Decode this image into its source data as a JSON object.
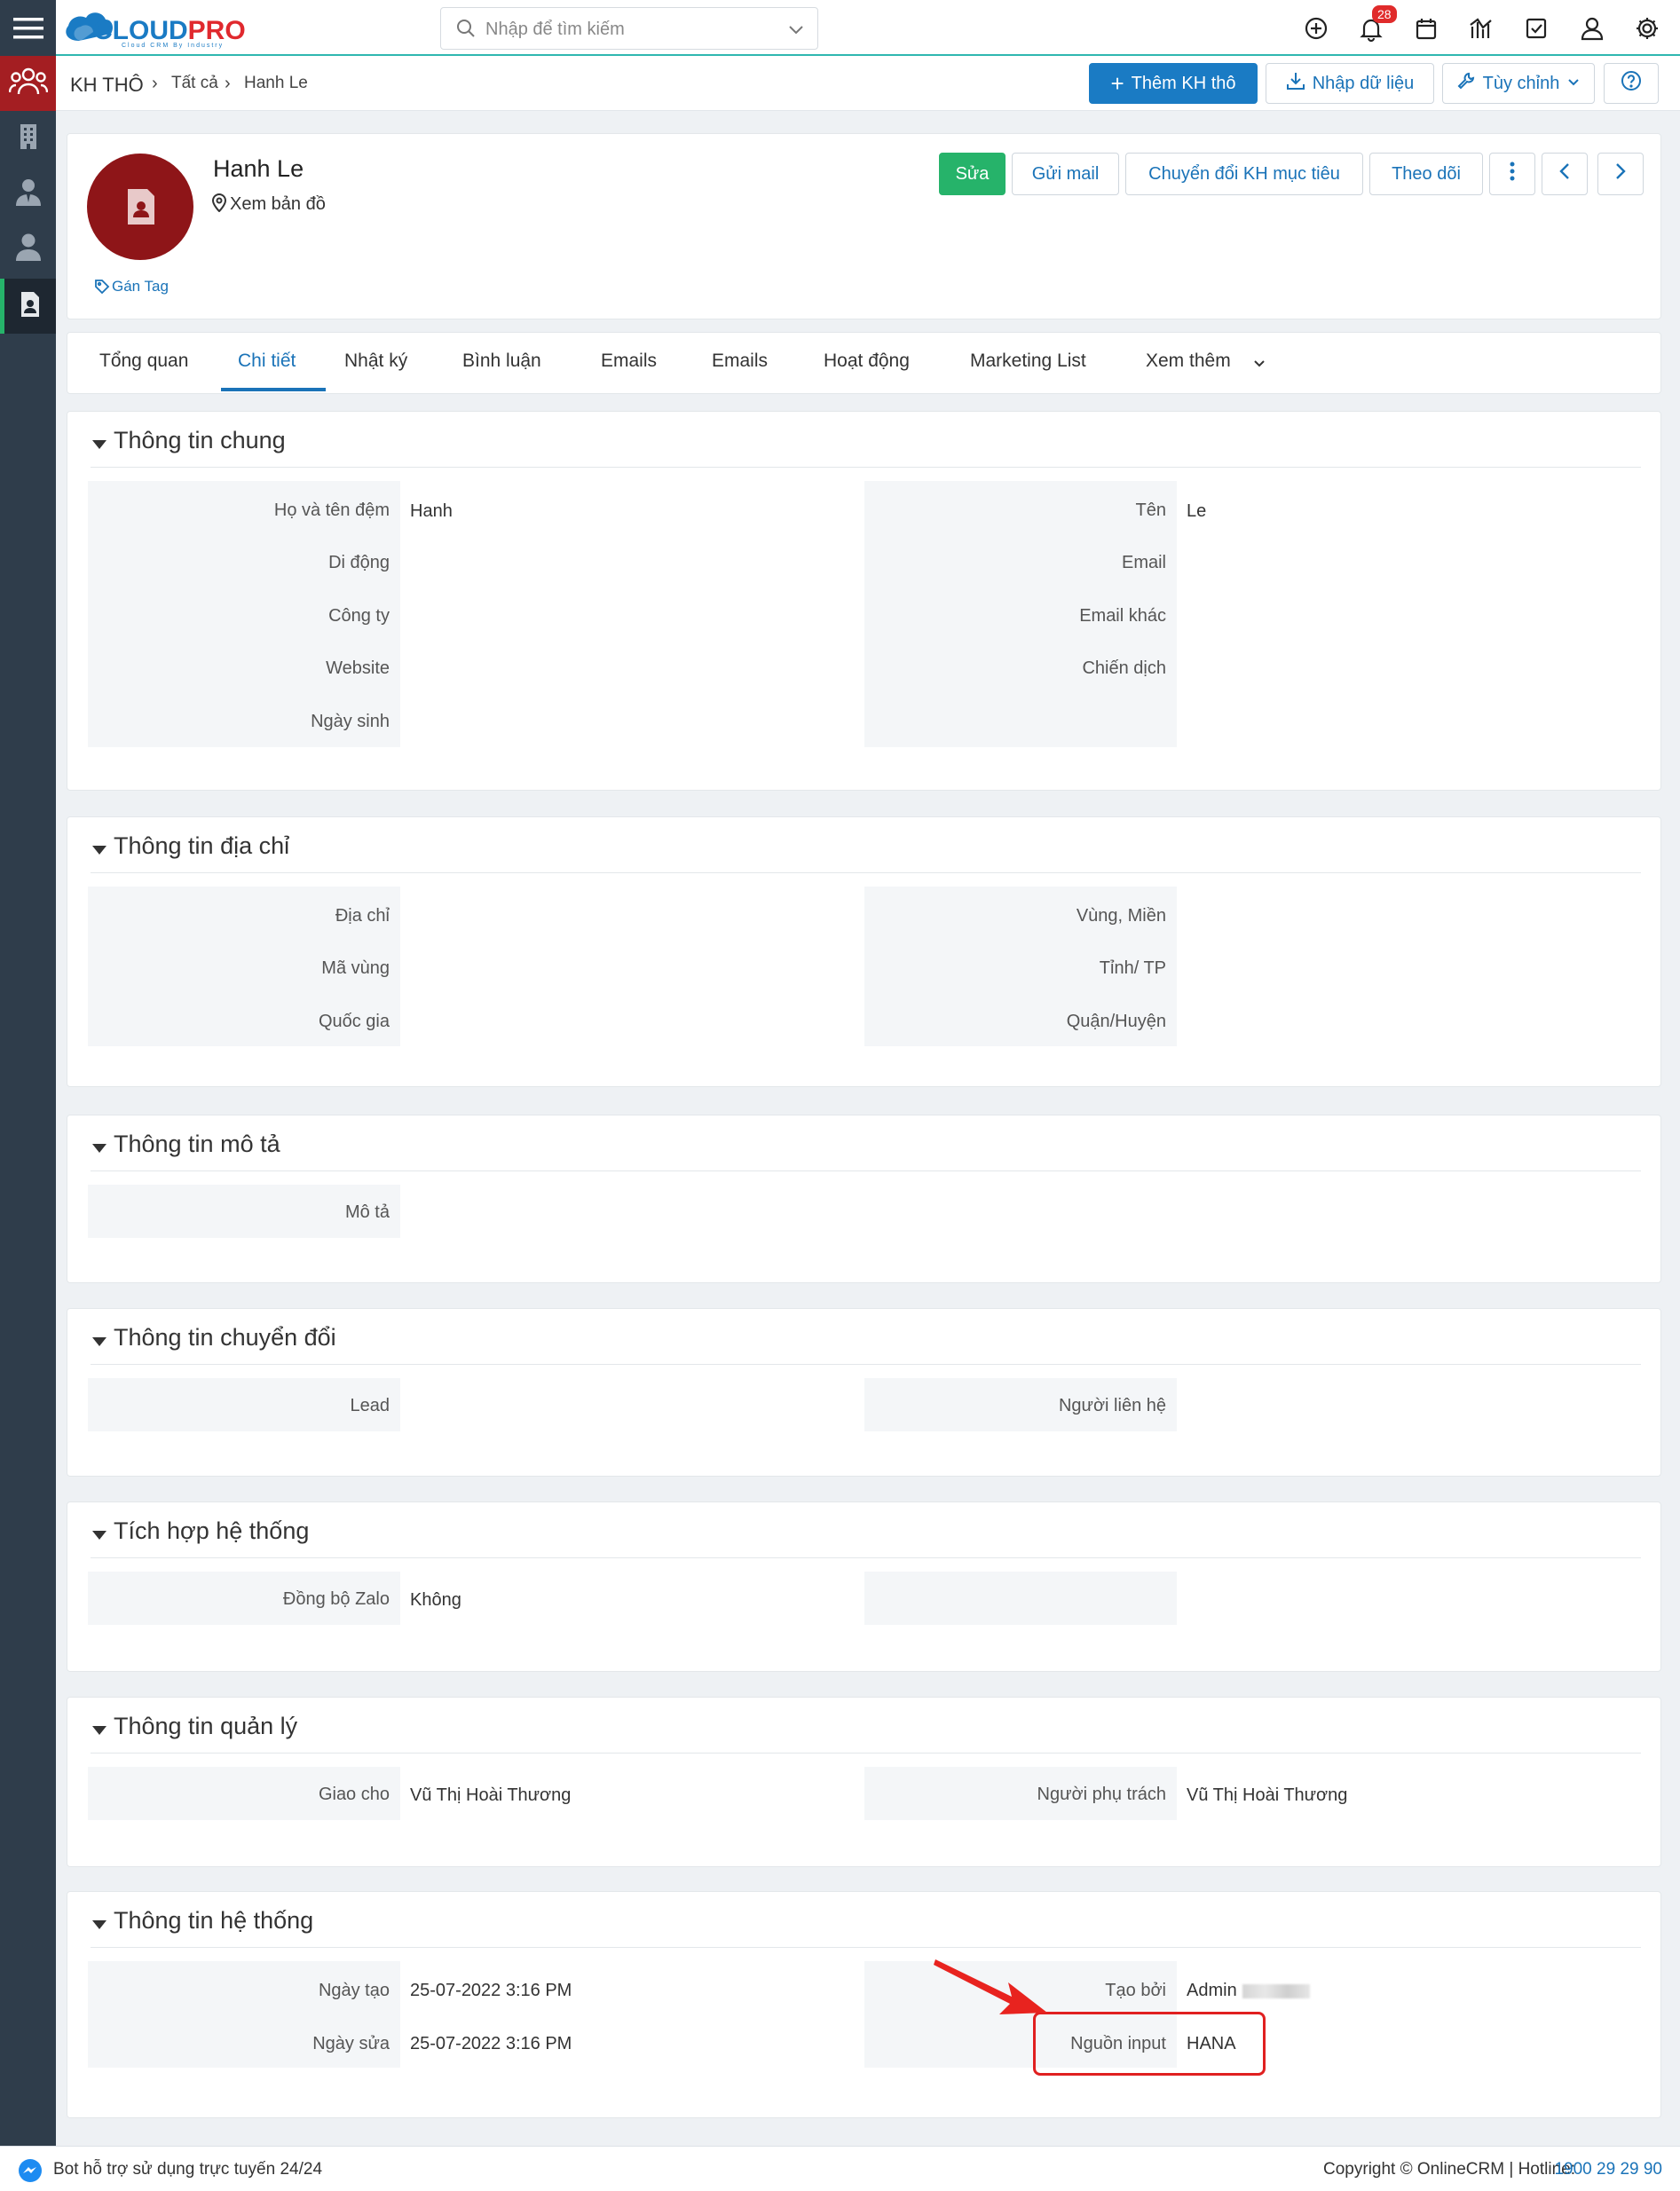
{
  "app": {
    "brand": "CLOUDPRO",
    "brand_tagline": "Cloud CRM By Industry"
  },
  "search": {
    "placeholder": "Nhập để tìm kiếm"
  },
  "topbar": {
    "notification_count": "28"
  },
  "breadcrumb": {
    "module": "KH THÔ",
    "list": "Tất cả",
    "current": "Hanh Le"
  },
  "toolbar": {
    "add_label": "Thêm KH thô",
    "import_label": "Nhập dữ liệu",
    "customize_label": "Tùy chỉnh"
  },
  "record": {
    "name": "Hanh Le",
    "map_link": "Xem bản đồ",
    "tag_link": "Gán Tag",
    "actions": {
      "edit": "Sửa",
      "send_mail": "Gửi mail",
      "convert": "Chuyển đổi KH mục tiêu",
      "follow": "Theo dõi"
    }
  },
  "tabs": [
    "Tổng quan",
    "Chi tiết",
    "Nhật ký",
    "Bình luận",
    "Emails",
    "Emails",
    "Hoạt động",
    "Marketing List",
    "Xem thêm"
  ],
  "sections": {
    "general": {
      "title": "Thông tin chung",
      "left": [
        {
          "label": "Họ và tên đệm",
          "value": "Hanh"
        },
        {
          "label": "Di động",
          "value": ""
        },
        {
          "label": "Công ty",
          "value": ""
        },
        {
          "label": "Website",
          "value": ""
        },
        {
          "label": "Ngày sinh",
          "value": ""
        }
      ],
      "right": [
        {
          "label": "Tên",
          "value": "Le"
        },
        {
          "label": "Email",
          "value": ""
        },
        {
          "label": "Email khác",
          "value": ""
        },
        {
          "label": "Chiến dịch",
          "value": ""
        }
      ]
    },
    "address": {
      "title": "Thông tin địa chỉ",
      "left": [
        {
          "label": "Địa chỉ",
          "value": ""
        },
        {
          "label": "Mã vùng",
          "value": ""
        },
        {
          "label": "Quốc gia",
          "value": ""
        }
      ],
      "right": [
        {
          "label": "Vùng, Miền",
          "value": ""
        },
        {
          "label": "Tỉnh/ TP",
          "value": ""
        },
        {
          "label": "Quận/Huyện",
          "value": ""
        }
      ]
    },
    "description": {
      "title": "Thông tin mô tả",
      "left": [
        {
          "label": "Mô tả",
          "value": ""
        }
      ]
    },
    "conversion": {
      "title": "Thông tin chuyển đổi",
      "left": [
        {
          "label": "Lead",
          "value": ""
        }
      ],
      "right": [
        {
          "label": "Người liên hệ",
          "value": ""
        }
      ]
    },
    "integration": {
      "title": "Tích hợp hệ thống",
      "left": [
        {
          "label": "Đồng bộ Zalo",
          "value": "Không"
        }
      ]
    },
    "management": {
      "title": "Thông tin quản lý",
      "left": [
        {
          "label": "Giao cho",
          "value": "Vũ Thị Hoài Thương"
        }
      ],
      "right": [
        {
          "label": "Người phụ trách",
          "value": "Vũ Thị Hoài Thương"
        }
      ]
    },
    "system": {
      "title": "Thông tin hệ thống",
      "left": [
        {
          "label": "Ngày tạo",
          "value": "25-07-2022 3:16 PM"
        },
        {
          "label": "Ngày sửa",
          "value": "25-07-2022 3:16 PM"
        }
      ],
      "right": [
        {
          "label": "Tạo bởi",
          "value": "Admin"
        },
        {
          "label": "Nguồn input",
          "value": "HANA"
        }
      ]
    }
  },
  "footer": {
    "bot_text": "Bot hỗ trợ sử dụng trực tuyến 24/24",
    "copyright": "Copyright © OnlineCRM | Hotline:",
    "hotline": "1900 29 29 90"
  },
  "colors": {
    "accent": "#1a73b8",
    "sidebar": "#2f3d4b",
    "brand_red": "#a41e22",
    "edit_green": "#26b36a",
    "highlight": "#e02020"
  }
}
